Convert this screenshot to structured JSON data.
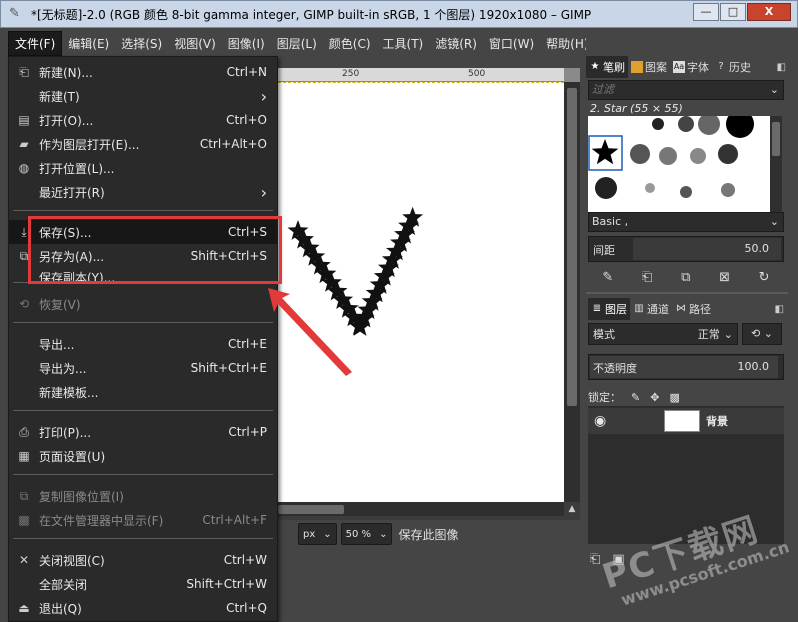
{
  "window": {
    "title": "*[无标题]-2.0 (RGB 颜色 8-bit gamma integer, GIMP built-in sRGB, 1 个图层) 1920x1080 – GIMP",
    "minimize": "—",
    "maximize": "□",
    "close": "X"
  },
  "menubar": [
    "文件(F)",
    "编辑(E)",
    "选择(S)",
    "视图(V)",
    "图像(I)",
    "图层(L)",
    "颜色(C)",
    "工具(T)",
    "滤镜(R)",
    "窗口(W)",
    "帮助(H)"
  ],
  "file_menu": [
    {
      "label": "新建(N)...",
      "shortcut": "Ctrl+N",
      "icon": "new-icon",
      "glyph": "⎗",
      "enabled": true
    },
    {
      "label": "新建(T)",
      "shortcut": "›",
      "icon": "",
      "glyph": "",
      "enabled": true
    },
    {
      "label": "打开(O)...",
      "shortcut": "Ctrl+O",
      "icon": "open-icon",
      "glyph": "▤",
      "enabled": true
    },
    {
      "label": "作为图层打开(E)...",
      "shortcut": "Ctrl+Alt+O",
      "icon": "open-as-layer-icon",
      "glyph": "▰",
      "enabled": true
    },
    {
      "label": "打开位置(L)...",
      "shortcut": "",
      "icon": "location-icon",
      "glyph": "◍",
      "enabled": true
    },
    {
      "label": "最近打开(R)",
      "shortcut": "›",
      "icon": "",
      "glyph": "",
      "enabled": true
    },
    {
      "label": "保存(S)...",
      "shortcut": "Ctrl+S",
      "icon": "save-icon",
      "glyph": "⤓",
      "enabled": true
    },
    {
      "label": "另存为(A)...",
      "shortcut": "Shift+Ctrl+S",
      "icon": "save-as-icon",
      "glyph": "⧉",
      "enabled": true
    },
    {
      "label": "保存副本(Y)...",
      "shortcut": "",
      "icon": "",
      "glyph": "",
      "enabled": true
    },
    {
      "label": "恢复(V)",
      "shortcut": "",
      "icon": "revert-icon",
      "glyph": "⟲",
      "enabled": false
    },
    {
      "label": "导出...",
      "shortcut": "Ctrl+E",
      "icon": "",
      "glyph": "",
      "enabled": true
    },
    {
      "label": "导出为...",
      "shortcut": "Shift+Ctrl+E",
      "icon": "",
      "glyph": "",
      "enabled": true
    },
    {
      "label": "新建模板...",
      "shortcut": "",
      "icon": "",
      "glyph": "",
      "enabled": true
    },
    {
      "label": "打印(P)...",
      "shortcut": "Ctrl+P",
      "icon": "print-icon",
      "glyph": "⎙",
      "enabled": true
    },
    {
      "label": "页面设置(U)",
      "shortcut": "",
      "icon": "page-setup-icon",
      "glyph": "▦",
      "enabled": true
    },
    {
      "label": "复制图像位置(I)",
      "shortcut": "",
      "icon": "copy-location-icon",
      "glyph": "⧉",
      "enabled": false
    },
    {
      "label": "在文件管理器中显示(F)",
      "shortcut": "Ctrl+Alt+F",
      "icon": "file-manager-icon",
      "glyph": "▩",
      "enabled": false
    },
    {
      "label": "关闭视图(C)",
      "shortcut": "Ctrl+W",
      "icon": "close-view-icon",
      "glyph": "✕",
      "enabled": true
    },
    {
      "label": "全部关闭",
      "shortcut": "Shift+Ctrl+W",
      "icon": "",
      "glyph": "",
      "enabled": true
    },
    {
      "label": "退出(Q)",
      "shortcut": "Ctrl+Q",
      "icon": "quit-icon",
      "glyph": "⏏",
      "enabled": true
    }
  ],
  "ruler": {
    "ticks": [
      "250",
      "500"
    ]
  },
  "statusbar": {
    "unit": "px",
    "zoom": "50 %",
    "message": "保存此图像"
  },
  "dock": {
    "tabs": [
      "笔刷",
      "图案",
      "字体",
      "历史"
    ],
    "filter_placeholder": "过滤",
    "brush_name": "2. Star (55 × 55)",
    "brush_set": "Basic ,",
    "spacing_label": "间距",
    "spacing_value": "50.0",
    "layer_tabs": [
      "图层",
      "通道",
      "路径"
    ],
    "mode_label": "模式",
    "mode_value": "正常",
    "opacity_label": "不透明度",
    "opacity_value": "100.0",
    "lock_label": "锁定：",
    "layer_name": "背景"
  },
  "watermark": {
    "main": "PC下载网",
    "url": "www.pcsoft.com.cn"
  },
  "colors": {
    "accent": "#e23a3a",
    "menu_bg": "#2a2a2a",
    "app_bg": "#454545"
  }
}
